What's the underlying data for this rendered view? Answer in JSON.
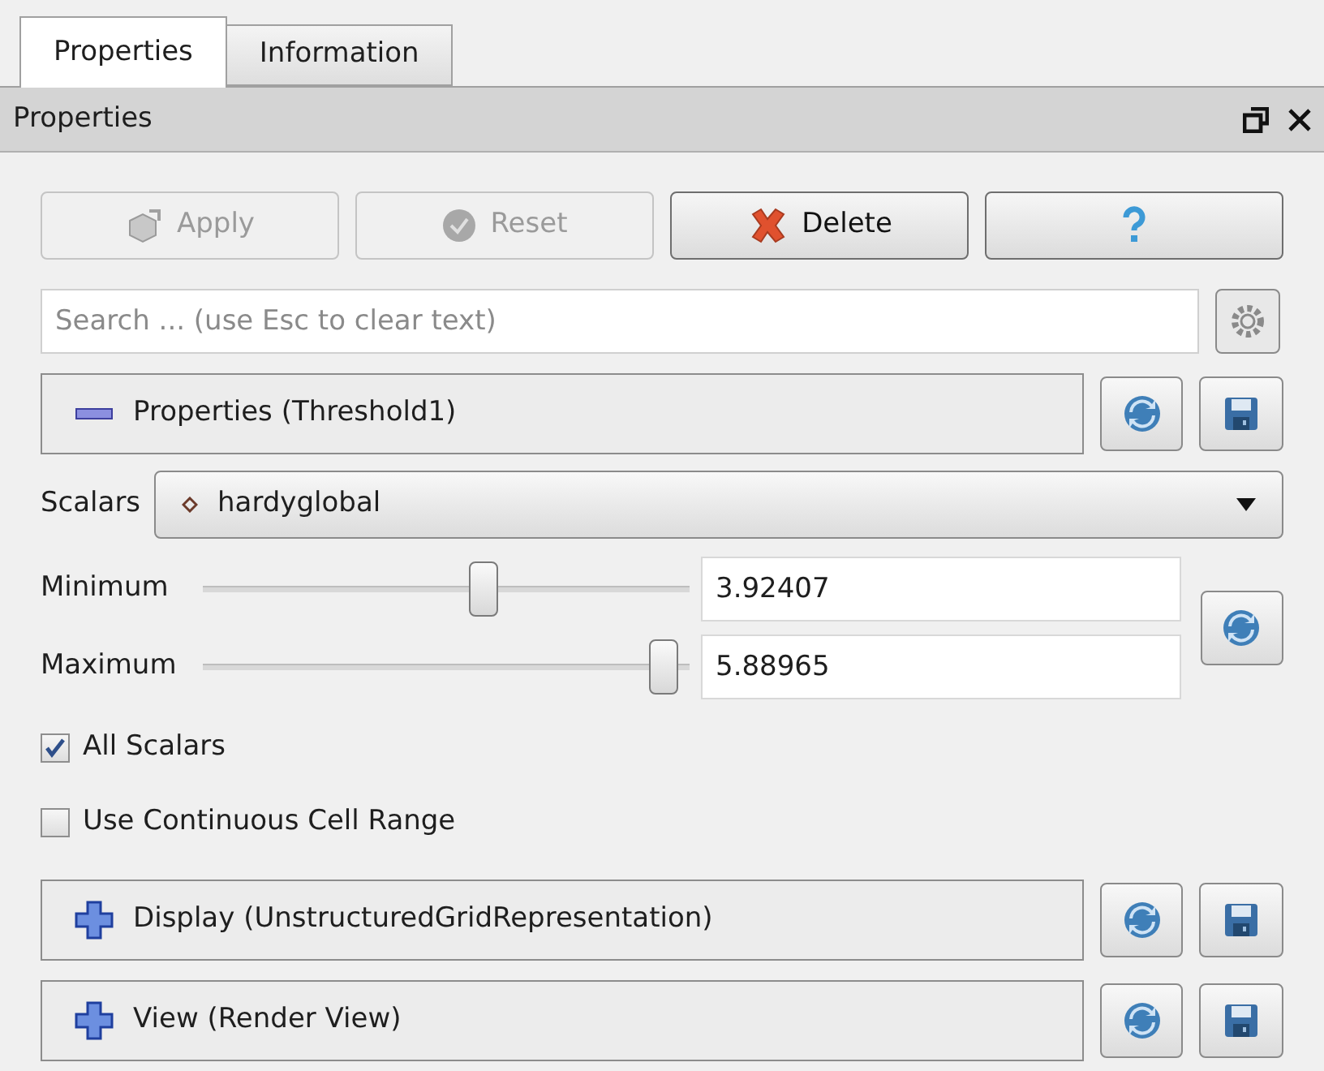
{
  "tabs": [
    {
      "label": "Properties",
      "selected": true
    },
    {
      "label": "Information",
      "selected": false
    }
  ],
  "panel": {
    "title": "Properties"
  },
  "buttons": [
    {
      "kind": "apply",
      "label": "Apply",
      "disabled": true
    },
    {
      "kind": "reset",
      "label": "Reset",
      "disabled": true
    },
    {
      "kind": "delete",
      "label": "Delete",
      "disabled": false
    },
    {
      "kind": "help",
      "disabled": false
    }
  ],
  "search": {
    "placeholder": "Search ... (use Esc to clear text)"
  },
  "sections": [
    {
      "title": "Properties (Threshold1)",
      "expanded": true
    },
    {
      "title": "Display (UnstructuredGridRepresentation)",
      "expanded": false
    },
    {
      "title": "View (Render View)",
      "expanded": false
    }
  ],
  "scalars": {
    "label": "Scalars",
    "value": "hardyglobal"
  },
  "ranges": [
    {
      "label": "Minimum",
      "level": 0.58,
      "value": "3.92407"
    },
    {
      "label": "Maximum",
      "level": 0.96,
      "value": "5.88965"
    }
  ],
  "checkboxes": [
    {
      "label": "All Scalars",
      "checked": true
    },
    {
      "label": "Use Continuous Cell Range",
      "checked": false
    }
  ]
}
